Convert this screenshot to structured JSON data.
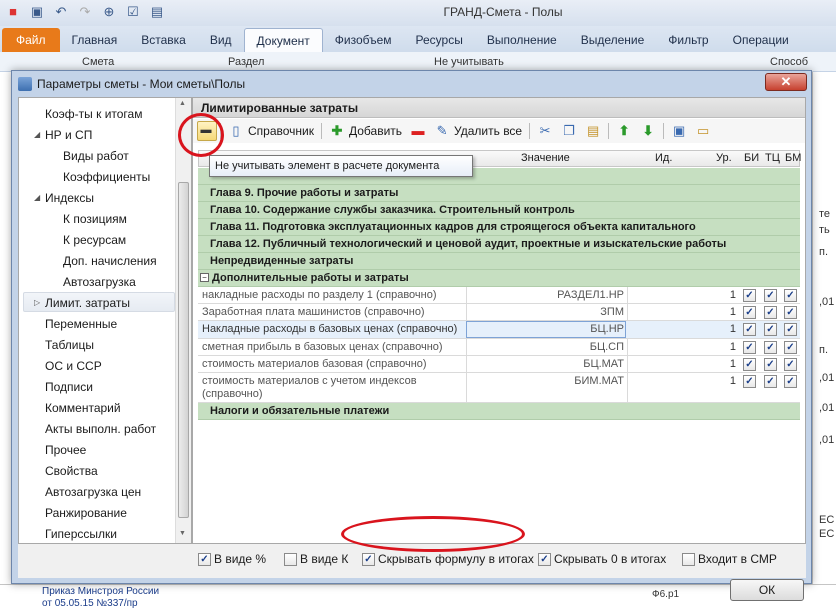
{
  "app": {
    "title": "ГРАНД-Смета - Полы"
  },
  "ribbon": {
    "tabs": [
      {
        "label": "Файл"
      },
      {
        "label": "Главная"
      },
      {
        "label": "Вставка"
      },
      {
        "label": "Вид"
      },
      {
        "label": "Документ"
      },
      {
        "label": "Физобъем"
      },
      {
        "label": "Ресурсы"
      },
      {
        "label": "Выполнение"
      },
      {
        "label": "Выделение"
      },
      {
        "label": "Фильтр"
      },
      {
        "label": "Операции"
      }
    ],
    "fragments": {
      "smeta": "Смета",
      "razdel": "Раздел",
      "ne_uchityvat": "Не учитывать",
      "sposob": "Способ расчет"
    }
  },
  "background": {
    "right_column": [
      "те",
      "ть",
      "п.",
      ",01",
      "п.",
      ",01",
      ",01",
      ",01"
    ],
    "right_bottom": [
      "ЕС",
      "ЕС"
    ],
    "bottom_line1": "Приказ Минстроя России",
    "bottom_line2": "от 05.05.15 №337/пр",
    "bottom_right": "Ф6.р1"
  },
  "dialog": {
    "title": "Параметры сметы - Мои сметы\\Полы",
    "close_label": "✕",
    "ok_label": "ОК"
  },
  "nav": {
    "items": [
      {
        "label": "Коэф-ты к итогам"
      },
      {
        "label": "НР и СП"
      },
      {
        "label": "Виды работ"
      },
      {
        "label": "Коэффициенты"
      },
      {
        "label": "Индексы"
      },
      {
        "label": "К позициям"
      },
      {
        "label": "К ресурсам"
      },
      {
        "label": "Доп. начисления"
      },
      {
        "label": "Автозагрузка"
      },
      {
        "label": "Лимит. затраты"
      },
      {
        "label": "Переменные"
      },
      {
        "label": "Таблицы"
      },
      {
        "label": "ОС и ССР"
      },
      {
        "label": "Подписи"
      },
      {
        "label": "Комментарий"
      },
      {
        "label": "Акты выполн. работ"
      },
      {
        "label": "Прочее"
      },
      {
        "label": "Свойства"
      },
      {
        "label": "Автозагрузка цен"
      },
      {
        "label": "Ранжирование"
      },
      {
        "label": "Гиперссылки"
      }
    ]
  },
  "panel": {
    "header": "Лимитированные затраты",
    "toolbar": {
      "spravochnik": "Справочник",
      "add": "Добавить",
      "delete_all": "Удалить все"
    },
    "tooltip": "Не учитывать элемент в расчете документа",
    "columns": {
      "value": "Значение",
      "id": "Ид.",
      "level": "Ур.",
      "bi": "БИ",
      "tc": "ТЦ",
      "bm": "БМ"
    },
    "groups": [
      {
        "label": "Глава 9. Прочие работы и затраты"
      },
      {
        "label": "Глава 10. Содержание службы заказчика. Строительный контроль"
      },
      {
        "label": "Глава 11. Подготовка эксплуатационных кадров для строящегося объекта капитального"
      },
      {
        "label": "Глава 12. Публичный технологический и ценовой аудит, проектные и изыскательские работы"
      },
      {
        "label": "Непредвиденные затраты"
      },
      {
        "label": "Дополнительные работы и затраты"
      }
    ],
    "rows": [
      {
        "name": "накладные расходы по разделу 1 (справочно)",
        "value": "РАЗДЕЛ1.НР",
        "level": "1",
        "bi": "✓",
        "tc": "✓",
        "bm": "✓"
      },
      {
        "name": "Заработная плата машинистов (справочно)",
        "value": "ЗПМ",
        "level": "1",
        "bi": "✓",
        "tc": "✓",
        "bm": "✓"
      },
      {
        "name": "Накладные расходы в базовых ценах (справочно)",
        "value": "БЦ.НР",
        "level": "1",
        "bi": "✓",
        "tc": "✓",
        "bm": "✓"
      },
      {
        "name": "сметная прибыль в базовых ценах (справочно)",
        "value": "БЦ.СП",
        "level": "1",
        "bi": "✓",
        "tc": "✓",
        "bm": "✓"
      },
      {
        "name": "стоимость материалов базовая (справочно)",
        "value": "БЦ.МАТ",
        "level": "1",
        "bi": "✓",
        "tc": "✓",
        "bm": "✓"
      },
      {
        "name": "стоимость материалов с учетом индексов (справочно)",
        "value": "БИМ.МАТ",
        "level": "1",
        "bi": "✓",
        "tc": "✓",
        "bm": "✓"
      }
    ],
    "last_group": {
      "label": "Налоги и обязательные платежи"
    },
    "expander_minus": "−"
  },
  "options": [
    {
      "label": "В виде %",
      "checked": "✓"
    },
    {
      "label": "В виде К",
      "checked": ""
    },
    {
      "label": "Скрывать формулу в итогах",
      "checked": "✓"
    },
    {
      "label": "Скрывать 0 в итогах",
      "checked": "✓"
    },
    {
      "label": "Входит в СМР",
      "checked": ""
    }
  ],
  "colors": {
    "group_row": "#c6dfc1",
    "highlight_circle": "#d9141d",
    "file_tab": "#e87a1a"
  }
}
